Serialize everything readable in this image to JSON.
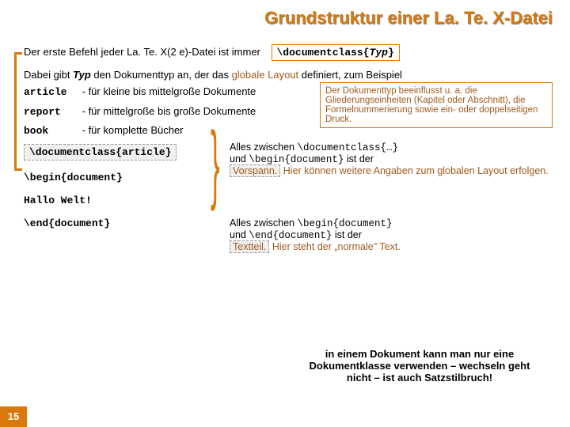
{
  "title": "Grundstruktur einer La. Te. X-Datei",
  "intro": "Der erste Befehl jeder La. Te. X(2 e)-Datei ist immer",
  "dc_cmd": "\\documentclass{",
  "dc_typ": "Typ",
  "dc_close": "}",
  "row2a": "Dabei gibt ",
  "row2b": "Typ",
  "row2c": " den Dokumenttyp an, der das ",
  "row2d": "globale Layout",
  "row2e": " definiert, zum Beispiel",
  "types": [
    {
      "kw": "article",
      "desc": "- für kleine bis mittelgroße Dokumente"
    },
    {
      "kw": "report",
      "desc": "- für mittelgroße bis große Dokumente"
    },
    {
      "kw": "book",
      "desc": "- für komplette Bücher"
    }
  ],
  "rightbox": "Der Dokumenttyp beeinflusst u. a. die Gliederungseinheiten (Kapitel oder Abschnitt), die Formelnummerierung sowie ein- oder doppelseitigen Druck.",
  "dc_article": "\\documentclass{article}",
  "code": {
    "begin": "\\begin{document}",
    "hello": "Hallo Welt!",
    "end": "\\end{document}"
  },
  "expl1a": "Alles zwischen ",
  "expl1b": "\\documentclass{…}",
  "expl1c": " und ",
  "expl1d": "\\begin{document}",
  "expl1e": " ist der ",
  "expl1f": "Vorspann.",
  "expl1g": " Hier können weitere Angaben zum globalen Layout erfolgen.",
  "expl2a": "Alles zwischen ",
  "expl2b": "\\begin{document}",
  "expl2c": " und ",
  "expl2d": "\\end{document}",
  "expl2e": " ist der ",
  "expl2f": "Textteil.",
  "expl2g": " Hier steht der „normale\" Text.",
  "footer": "in einem Dokument kann man nur eine Dokumentklasse verwenden – wechseln geht nicht – ist auch Satzstilbruch!",
  "pagenum": "15"
}
